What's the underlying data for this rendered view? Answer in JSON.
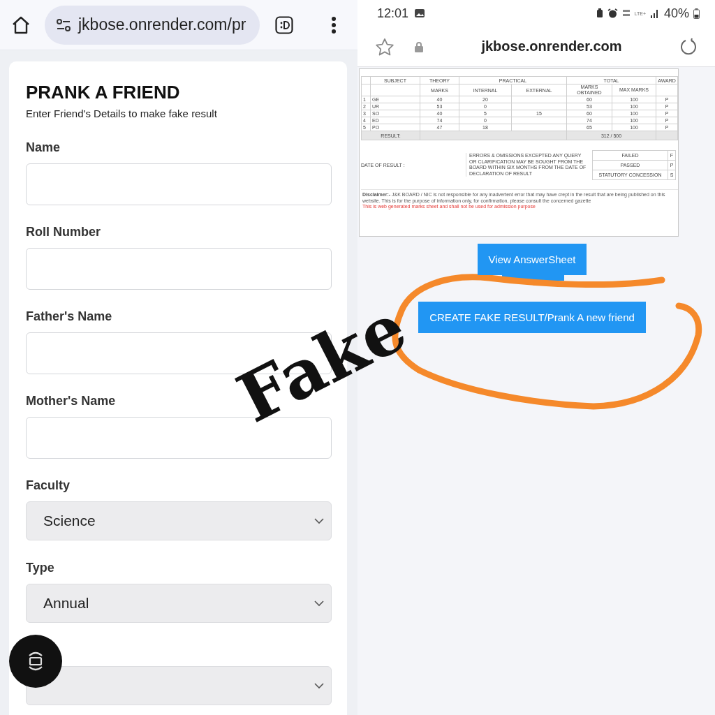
{
  "left": {
    "address_bar": {
      "url": "jkbose.onrender.com/pr"
    },
    "form": {
      "title": "PRANK A FRIEND",
      "subtitle": "Enter Friend's Details to make fake result",
      "fields": [
        {
          "kind": "text",
          "label": "Name"
        },
        {
          "kind": "text",
          "label": "Roll Number"
        },
        {
          "kind": "text",
          "label": "Father's Name"
        },
        {
          "kind": "text",
          "label": "Mother's Name"
        },
        {
          "kind": "select",
          "label": "Faculty",
          "value": "Science"
        },
        {
          "kind": "select",
          "label": "Type",
          "value": "Annual"
        },
        {
          "kind": "select"
        }
      ]
    }
  },
  "right": {
    "status_bar": {
      "time": "12:01",
      "network": "LTE+",
      "battery": "40%"
    },
    "address_bar": {
      "url": "jkbose.onrender.com"
    },
    "result_table": {
      "header_top": [
        "SUBJECT",
        "THEORY",
        "PRACTICAL",
        "TOTAL",
        "AWARD"
      ],
      "header_sub": [
        "MARKS",
        "INTERNAL",
        "EXTERNAL",
        "MARKS OBTAINED",
        "MAX MARKS"
      ],
      "rows": [
        [
          "1",
          "GE",
          "40",
          "20",
          "",
          "60",
          "100",
          "P"
        ],
        [
          "2",
          "UR",
          "53",
          "0",
          "",
          "53",
          "100",
          "P"
        ],
        [
          "3",
          "SO",
          "40",
          "5",
          "15",
          "60",
          "100",
          "P"
        ],
        [
          "4",
          "ED",
          "74",
          "0",
          "",
          "74",
          "100",
          "P"
        ],
        [
          "5",
          "PO",
          "47",
          "18",
          "",
          "65",
          "100",
          "P"
        ]
      ],
      "result_label": "RESULT:",
      "result_value": "312 / 500",
      "date_label": "DATE OF RESULT :",
      "note": "ERRORS & OMISSIONS EXCEPTED ANY QUERY OR CLARIFICATION MAY BE SOUGHT FROM THE BOARD WITHIN SIX MONTHS FROM THE DATE OF DECLARATION OF RESULT",
      "legend": [
        [
          "FAILED",
          "F"
        ],
        [
          "PASSED",
          "P"
        ],
        [
          "STATUTORY CONCESSION",
          "S"
        ]
      ],
      "disclaimer": "**Disclaimer:-** J&K BOARD / NIC is not responsible for any inadvertent error that may have crept in the result that are being published on this website. This is for the purpose of information only, for confirmation, please consult the concerned gazette",
      "warning": "This is web generated marks sheet and shall not be used for admission purpose"
    },
    "buttons": [
      {
        "kind": "primary",
        "label": "View AnswerSheet"
      },
      {
        "kind": "hidden"
      },
      {
        "kind": "primary",
        "label": "CREATE FAKE RESULT/Prank A new friend"
      }
    ]
  },
  "annotation": {
    "text": "Fake"
  }
}
